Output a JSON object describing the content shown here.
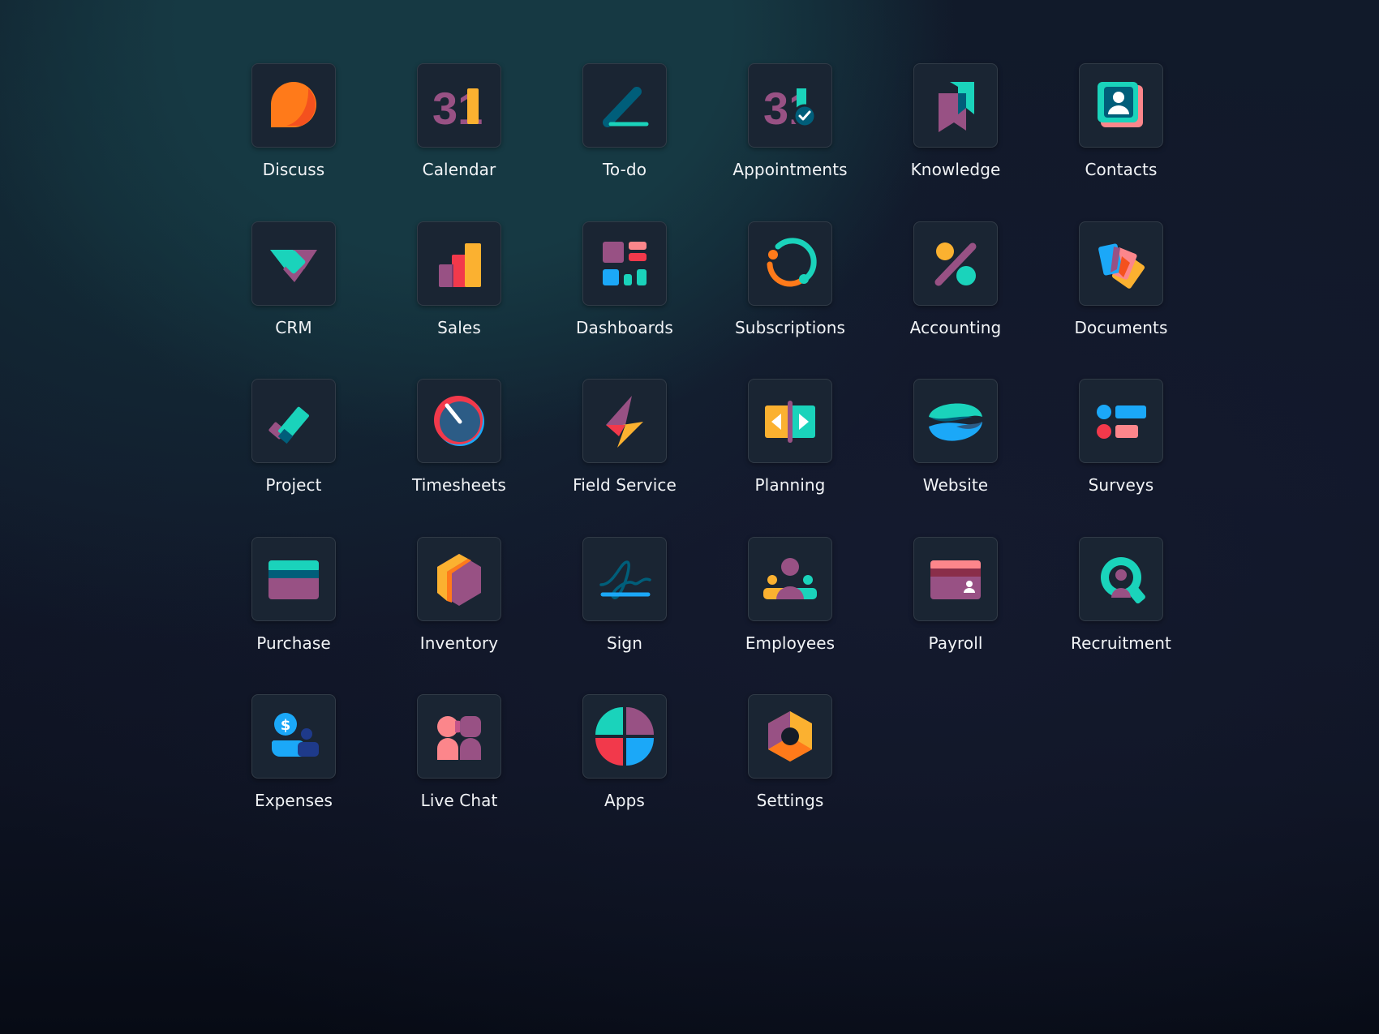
{
  "apps": [
    {
      "label": "Discuss",
      "icon": "discuss-icon"
    },
    {
      "label": "Calendar",
      "icon": "calendar-icon",
      "icon_text": "31"
    },
    {
      "label": "To-do",
      "icon": "todo-icon"
    },
    {
      "label": "Appointments",
      "icon": "appointments-icon",
      "icon_text": "31"
    },
    {
      "label": "Knowledge",
      "icon": "knowledge-icon"
    },
    {
      "label": "Contacts",
      "icon": "contacts-icon"
    },
    {
      "label": "CRM",
      "icon": "crm-icon"
    },
    {
      "label": "Sales",
      "icon": "sales-icon"
    },
    {
      "label": "Dashboards",
      "icon": "dashboards-icon"
    },
    {
      "label": "Subscriptions",
      "icon": "subscriptions-icon"
    },
    {
      "label": "Accounting",
      "icon": "accounting-icon"
    },
    {
      "label": "Documents",
      "icon": "documents-icon"
    },
    {
      "label": "Project",
      "icon": "project-icon"
    },
    {
      "label": "Timesheets",
      "icon": "timesheets-icon"
    },
    {
      "label": "Field Service",
      "icon": "field-service-icon"
    },
    {
      "label": "Planning",
      "icon": "planning-icon"
    },
    {
      "label": "Website",
      "icon": "website-icon"
    },
    {
      "label": "Surveys",
      "icon": "surveys-icon"
    },
    {
      "label": "Purchase",
      "icon": "purchase-icon"
    },
    {
      "label": "Inventory",
      "icon": "inventory-icon"
    },
    {
      "label": "Sign",
      "icon": "sign-icon"
    },
    {
      "label": "Employees",
      "icon": "employees-icon"
    },
    {
      "label": "Payroll",
      "icon": "payroll-icon"
    },
    {
      "label": "Recruitment",
      "icon": "recruitment-icon"
    },
    {
      "label": "Expenses",
      "icon": "expenses-icon",
      "icon_text": "$"
    },
    {
      "label": "Live Chat",
      "icon": "live-chat-icon"
    },
    {
      "label": "Apps",
      "icon": "apps-icon"
    },
    {
      "label": "Settings",
      "icon": "settings-icon"
    }
  ],
  "colors": {
    "orange": "#FF7A1A",
    "yellow": "#FBB130",
    "purple": "#985184",
    "teal": "#1AD3BB",
    "dark_teal": "#005E7A",
    "blue": "#1BA8F8",
    "coral": "#FC868B",
    "red": "#F2394B",
    "tile_bg": "#1A2533",
    "label_text": "#F2F4F7"
  }
}
